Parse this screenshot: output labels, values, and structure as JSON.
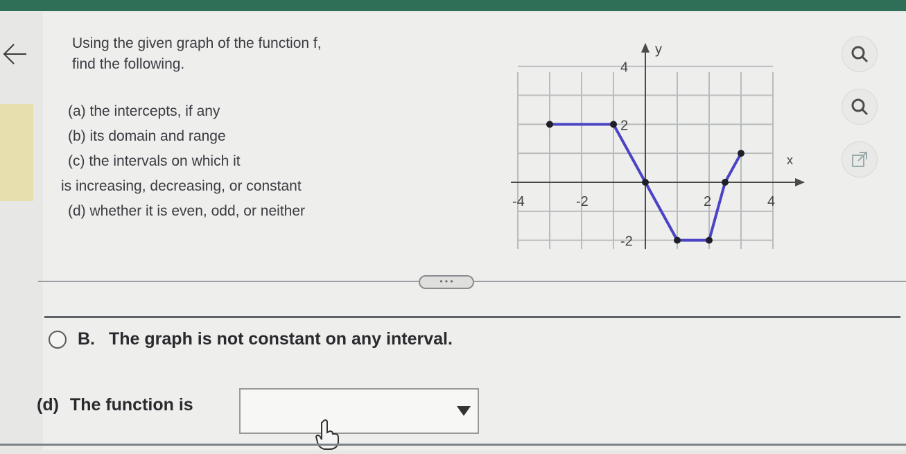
{
  "prompt": {
    "line1": "Using the given graph of the function f,",
    "line2": "find the following."
  },
  "items": {
    "a": "(a)  the intercepts, if any",
    "b": "(b)  its domain and range",
    "c1": "(c)  the intervals on which it",
    "c2": "is increasing, decreasing, or constant",
    "d": "(d)  whether it is even, odd, or neither"
  },
  "graph": {
    "axis_x_label": "x",
    "axis_y_label": "y",
    "x_ticks": [
      "-4",
      "-2",
      "2",
      "4"
    ],
    "y_ticks": [
      "4",
      "2",
      "-2"
    ],
    "polyline": [
      [
        -3,
        2
      ],
      [
        -1,
        2
      ],
      [
        0,
        0
      ],
      [
        1,
        -2
      ],
      [
        2,
        -2
      ],
      [
        2.5,
        0
      ],
      [
        3,
        1
      ]
    ],
    "line_color": "#4a43c4",
    "point_color": "#1f1f2a"
  },
  "tools": {
    "search1_icon": "magnifier-icon",
    "search2_icon": "magnifier-icon",
    "popout_icon": "external-link-icon"
  },
  "choice_b": {
    "letter": "B.",
    "text": "The graph is not constant on any interval."
  },
  "question_d": {
    "letter": "(d)",
    "text": "The function is",
    "select_value": ""
  }
}
